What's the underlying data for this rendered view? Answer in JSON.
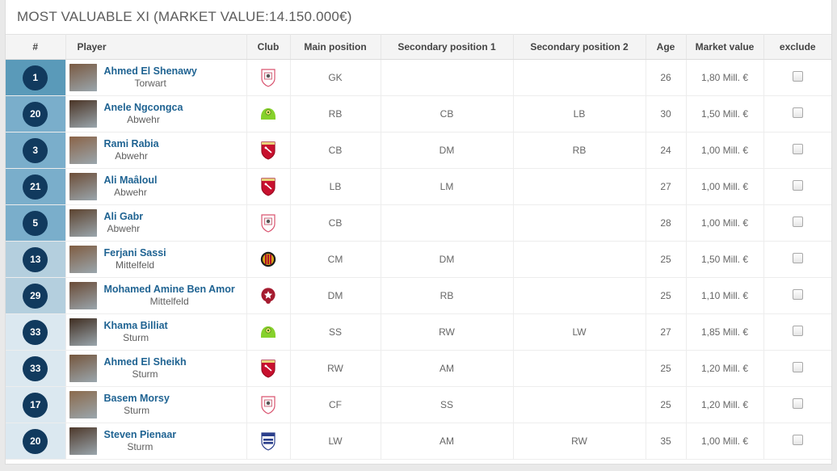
{
  "panel": {
    "title": "MOST VALUABLE XI (MARKET VALUE:14.150.000€)"
  },
  "table": {
    "columns": [
      {
        "key": "num",
        "label": "#"
      },
      {
        "key": "player",
        "label": "Player"
      },
      {
        "key": "club",
        "label": "Club"
      },
      {
        "key": "main",
        "label": "Main position"
      },
      {
        "key": "sec1",
        "label": "Secondary position 1"
      },
      {
        "key": "sec2",
        "label": "Secondary position 2"
      },
      {
        "key": "age",
        "label": "Age"
      },
      {
        "key": "value",
        "label": "Market value"
      },
      {
        "key": "exclude",
        "label": "exclude"
      }
    ],
    "rows": [
      {
        "num": "1",
        "name": "Ahmed El Shenawy",
        "role": "Torwart",
        "club": "zamalek",
        "main": "GK",
        "sec1": "",
        "sec2": "",
        "age": "26",
        "value": "1,80 Mill. €",
        "group": "grp-def",
        "checked": false
      },
      {
        "num": "20",
        "name": "Anele Ngcongca",
        "role": "Abwehr",
        "club": "green",
        "main": "RB",
        "sec1": "CB",
        "sec2": "LB",
        "age": "30",
        "value": "1,50 Mill. €",
        "group": "grp-def2",
        "checked": false
      },
      {
        "num": "3",
        "name": "Rami Rabia",
        "role": "Abwehr",
        "club": "alahly",
        "main": "CB",
        "sec1": "DM",
        "sec2": "RB",
        "age": "24",
        "value": "1,00 Mill. €",
        "group": "grp-def2",
        "checked": false
      },
      {
        "num": "21",
        "name": "Ali Maâloul",
        "role": "Abwehr",
        "club": "alahly",
        "main": "LB",
        "sec1": "LM",
        "sec2": "",
        "age": "27",
        "value": "1,00 Mill. €",
        "group": "grp-def2",
        "checked": false
      },
      {
        "num": "5",
        "name": "Ali Gabr",
        "role": "Abwehr",
        "club": "zamalek",
        "main": "CB",
        "sec1": "",
        "sec2": "",
        "age": "28",
        "value": "1,00 Mill. €",
        "group": "grp-def2",
        "checked": false
      },
      {
        "num": "13",
        "name": "Ferjani Sassi",
        "role": "Mittelfeld",
        "club": "esperance",
        "main": "CM",
        "sec1": "DM",
        "sec2": "",
        "age": "25",
        "value": "1,50 Mill. €",
        "group": "grp-mid",
        "checked": false
      },
      {
        "num": "29",
        "name": "Mohamed Amine Ben Amor",
        "role": "Mittelfeld",
        "club": "etoile",
        "main": "DM",
        "sec1": "RB",
        "sec2": "",
        "age": "25",
        "value": "1,10 Mill. €",
        "group": "grp-mid",
        "checked": false
      },
      {
        "num": "33",
        "name": "Khama Billiat",
        "role": "Sturm",
        "club": "green",
        "main": "SS",
        "sec1": "RW",
        "sec2": "LW",
        "age": "27",
        "value": "1,85 Mill. €",
        "group": "grp-att",
        "checked": false
      },
      {
        "num": "33",
        "name": "Ahmed El Sheikh",
        "role": "Sturm",
        "club": "alahly",
        "main": "RW",
        "sec1": "AM",
        "sec2": "",
        "age": "25",
        "value": "1,20 Mill. €",
        "group": "grp-att",
        "checked": false
      },
      {
        "num": "17",
        "name": "Basem Morsy",
        "role": "Sturm",
        "club": "zamalek",
        "main": "CF",
        "sec1": "SS",
        "sec2": "",
        "age": "25",
        "value": "1,20 Mill. €",
        "group": "grp-att",
        "checked": false
      },
      {
        "num": "20",
        "name": "Steven Pienaar",
        "role": "Sturm",
        "club": "bidvest",
        "main": "LW",
        "sec1": "AM",
        "sec2": "RW",
        "age": "35",
        "value": "1,00 Mill. €",
        "group": "grp-att",
        "checked": false
      }
    ]
  },
  "colors": {
    "link": "#1f6392",
    "badge": "#113a5e",
    "defense_band": "#5a9ab9",
    "midfield_band": "#b4cfde",
    "attack_band": "#dbe8f0",
    "header_bg": "#f4f4f4"
  }
}
